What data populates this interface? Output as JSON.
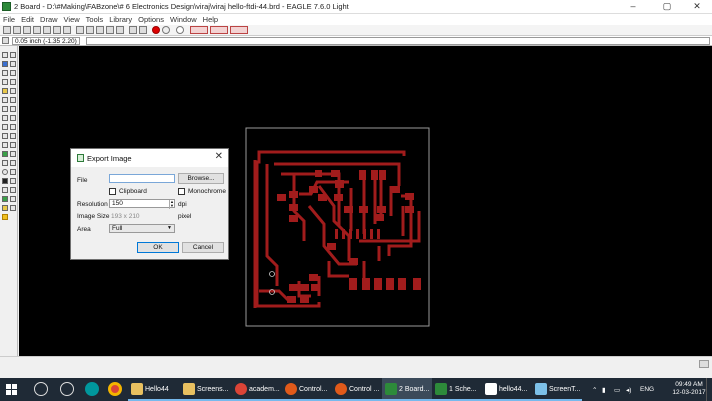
{
  "window": {
    "title": "2 Board - D:\\#Making\\FABzone\\# 6 Electronics Design\\viraj\\viraj hello-ftdi-44.brd - EAGLE 7.6.0 Light"
  },
  "menu": [
    "File",
    "Edit",
    "Draw",
    "View",
    "Tools",
    "Library",
    "Options",
    "Window",
    "Help"
  ],
  "coord": "0.05 inch (-1.35 2.20)",
  "dialog": {
    "title": "Export Image",
    "file_label": "File",
    "file_value": "",
    "browse": "Browse...",
    "clipboard": "Clipboard",
    "monochrome": "Monochrome",
    "resolution_label": "Resolution",
    "resolution_value": "150",
    "dpi": "dpi",
    "image_size_label": "Image Size",
    "image_size_value": "193 x 210",
    "pixel": "pixel",
    "area_label": "Area",
    "area_value": "Full",
    "ok": "OK",
    "cancel": "Cancel"
  },
  "taskbar": {
    "items": [
      "Hello44",
      "Screens...",
      "academ...",
      "Control...",
      "Control ...",
      "2 Board...",
      "1 Sche...",
      "hello44...",
      "ScreenT..."
    ],
    "lang": "ENG",
    "time": "09:49 AM",
    "date": "12-03-2017"
  },
  "colors": {
    "trace": "#a11c1c",
    "canvas": "#000000",
    "board_outline": "#9a9a9a",
    "taskbar": "#1f2a36"
  }
}
